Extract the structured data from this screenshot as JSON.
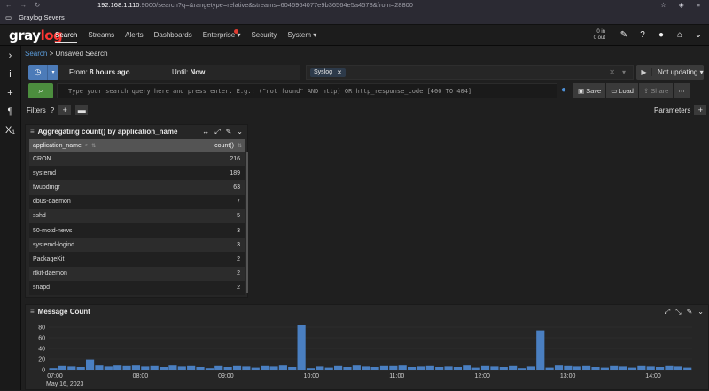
{
  "browser": {
    "url_host": "192.168.1.110",
    "url_rest": ":9000/search?q=&rangetype=relative&streams=6046964077e9b36564e5a4578&from=28800"
  },
  "bookmarks": {
    "item": "Graylog Severs"
  },
  "nav": {
    "logo_a": "gray",
    "logo_b": "log",
    "items": [
      "Search",
      "Streams",
      "Alerts",
      "Dashboards",
      "Enterprise",
      "Security",
      "System"
    ],
    "throughput_in": "0 in",
    "throughput_out": "0 out"
  },
  "breadcrumb": {
    "link": "Search",
    "current": "Unsaved Search"
  },
  "timerange": {
    "from_label": "From:",
    "from_value": "8 hours ago",
    "until_label": "Until:",
    "until_value": "Now"
  },
  "streams": {
    "selected": "Syslog"
  },
  "refresh": {
    "label": "Not updating"
  },
  "query": {
    "placeholder": "Type your search query here and press enter. E.g.: (\"not found\" AND http) OR http_response_code:[400 TO 404]",
    "save": "Save",
    "load": "Load",
    "share": "Share"
  },
  "filters": {
    "label": "Filters"
  },
  "parameters": {
    "label": "Parameters"
  },
  "aggregation_widget": {
    "title": "Aggregating count() by application_name",
    "columns": [
      "application_name",
      "count()"
    ],
    "rows": [
      {
        "name": "CRON",
        "count": "216"
      },
      {
        "name": "systemd",
        "count": "189"
      },
      {
        "name": "fwupdmgr",
        "count": "63"
      },
      {
        "name": "dbus-daemon",
        "count": "7"
      },
      {
        "name": "sshd",
        "count": "5"
      },
      {
        "name": "50-motd-news",
        "count": "3"
      },
      {
        "name": "systemd-logind",
        "count": "3"
      },
      {
        "name": "PackageKit",
        "count": "2"
      },
      {
        "name": "rtkit-daemon",
        "count": "2"
      },
      {
        "name": "snapd",
        "count": "2"
      }
    ]
  },
  "message_count_widget": {
    "title": "Message Count"
  },
  "chart_data": {
    "type": "bar",
    "title": "Message Count",
    "xlabel": "",
    "ylabel": "",
    "ylim": [
      0,
      90
    ],
    "yticks": [
      0,
      20,
      40,
      60,
      80
    ],
    "xticks": [
      "07:00",
      "08:00",
      "09:00",
      "10:00",
      "11:00",
      "12:00",
      "13:00",
      "14:00"
    ],
    "date_label": "May 16, 2023",
    "bar_color": "#4a7fc1",
    "values": [
      3,
      7,
      6,
      5,
      19,
      8,
      6,
      8,
      7,
      8,
      6,
      7,
      5,
      8,
      6,
      7,
      5,
      3,
      7,
      5,
      7,
      6,
      4,
      7,
      6,
      8,
      5,
      85,
      3,
      6,
      4,
      7,
      5,
      8,
      6,
      5,
      7,
      7,
      8,
      5,
      6,
      7,
      5,
      6,
      5,
      8,
      4,
      7,
      6,
      5,
      7,
      3,
      6,
      74,
      4,
      8,
      7,
      6,
      7,
      5,
      4,
      7,
      6,
      4,
      7,
      6,
      5,
      7,
      6,
      4
    ]
  }
}
